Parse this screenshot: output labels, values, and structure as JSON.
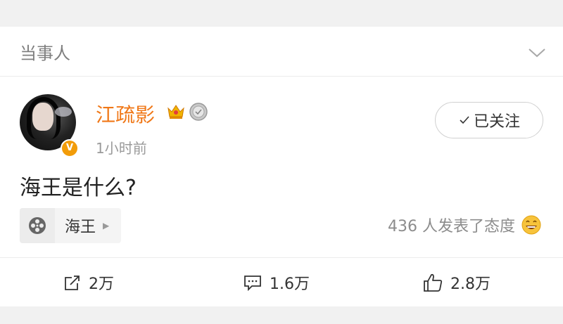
{
  "section": {
    "title": "当事人",
    "collapse_icon": "chevron-down-icon"
  },
  "post": {
    "author": "江疏影",
    "verified_badge": "V",
    "time": "1小时前",
    "follow_label": "已关注",
    "text": "海王是什么?",
    "topic": {
      "label": "海王",
      "icon": "film-reel-icon"
    },
    "attitude_text": "436 人发表了态度",
    "brand_color": "#f07818"
  },
  "actions": {
    "repost": "2万",
    "comment": "1.6万",
    "like": "2.8万"
  }
}
